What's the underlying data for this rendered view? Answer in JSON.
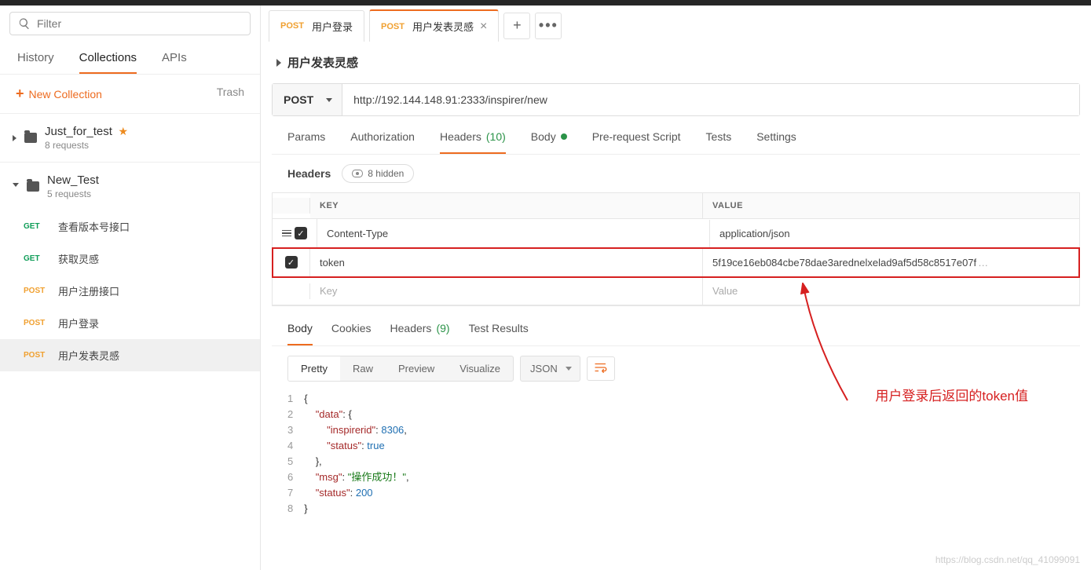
{
  "sidebar": {
    "filter_placeholder": "Filter",
    "nav": {
      "history": "History",
      "collections": "Collections",
      "apis": "APIs"
    },
    "new_collection": "New Collection",
    "trash": "Trash",
    "collections": [
      {
        "name": "Just_for_test",
        "sub": "8 requests",
        "starred": true,
        "open": false
      },
      {
        "name": "New_Test",
        "sub": "5 requests",
        "starred": false,
        "open": true
      }
    ],
    "requests": [
      {
        "method": "GET",
        "name": "查看版本号接口"
      },
      {
        "method": "GET",
        "name": "获取灵感"
      },
      {
        "method": "POST",
        "name": "用户注册接口"
      },
      {
        "method": "POST",
        "name": "用户登录"
      },
      {
        "method": "POST",
        "name": "用户发表灵感"
      }
    ]
  },
  "tabs": [
    {
      "method": "POST",
      "title": "用户登录",
      "active": false
    },
    {
      "method": "POST",
      "title": "用户发表灵感",
      "active": true
    }
  ],
  "request": {
    "title": "用户发表灵感",
    "method": "POST",
    "url": "http://192.144.148.91:2333/inspirer/new",
    "tabs": {
      "params": "Params",
      "authorization": "Authorization",
      "headers": "Headers",
      "headers_count": "(10)",
      "body": "Body",
      "prereq": "Pre-request Script",
      "tests": "Tests",
      "settings": "Settings"
    },
    "headers_label": "Headers",
    "hidden_label": "8 hidden",
    "col_key": "KEY",
    "col_value": "VALUE",
    "key_placeholder": "Key",
    "value_placeholder": "Value",
    "rows": [
      {
        "key": "Content-Type",
        "value": "application/json"
      },
      {
        "key": "token",
        "value": "5f19ce16eb084cbe78dae3arednelxelad9af5d58c8517e07f"
      }
    ]
  },
  "response": {
    "tabs": {
      "body": "Body",
      "cookies": "Cookies",
      "headers": "Headers",
      "headers_count": "(9)",
      "tests": "Test Results"
    },
    "view": {
      "pretty": "Pretty",
      "raw": "Raw",
      "preview": "Preview",
      "visualize": "Visualize",
      "format": "JSON"
    },
    "json": {
      "data": {
        "inspirerid": 8306,
        "status": true
      },
      "msg": "操作成功！",
      "status": 200
    }
  },
  "annotation": "用户登录后返回的token值",
  "watermark": "https://blog.csdn.net/qq_41099091"
}
